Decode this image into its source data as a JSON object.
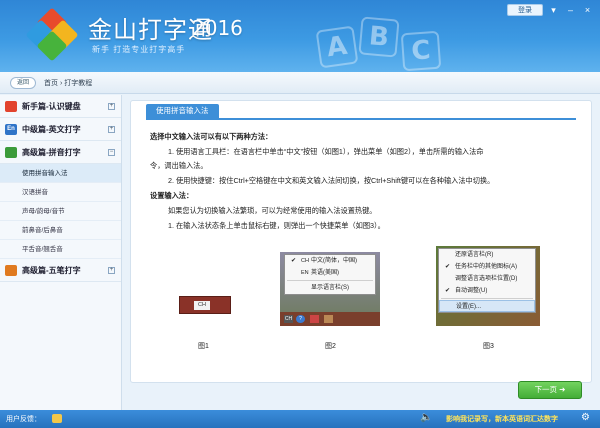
{
  "header": {
    "title": "金山打字通",
    "year": "2016",
    "subtitle": "新手 打造专业打字高手",
    "abc_letters": [
      "A",
      "B",
      "C"
    ],
    "login": "登录",
    "window_buttons": [
      "▾",
      "–",
      "×"
    ]
  },
  "nav": {
    "back": "返回",
    "breadcrumb": "首页 › 打字教程"
  },
  "sidebar": {
    "sections": [
      {
        "badge": "",
        "badge_color": "#e2432d",
        "label": "新手篇-认识键盘",
        "toggle": "+"
      },
      {
        "badge": "En",
        "badge_color": "#2f74c8",
        "label": "中级篇-英文打字",
        "toggle": "+"
      },
      {
        "badge": "",
        "badge_color": "#3b9b3a",
        "label": "高级篇-拼音打字",
        "toggle": "−"
      },
      {
        "badge": "",
        "badge_color": "#e07a1f",
        "label": "高级篇-五笔打字",
        "toggle": "+"
      }
    ],
    "subitems": [
      "使用拼音输入法",
      "汉语拼音",
      "声母/韵母/音节",
      "前鼻音/后鼻音",
      "平舌音/翘舌音"
    ]
  },
  "content": {
    "tab": "使用拼音输入法",
    "lines": [
      "选择中文输入法可以有以下两种方法：",
      "1. 使用语言工具栏：在语言栏中单击“中文”按钮（如图1），弹出菜单（如图2），单击所需的输入法命",
      "令，调出输入法。",
      "2. 使用快捷键：按住Ctrl+空格键在中文和英文输入法间切换，按Ctrl+Shift键可以在各种输入法中切换。",
      "设置输入法：",
      "如果您认为切换输入法繁琐，可以为经常使用的输入法设置热键。",
      "1. 在输入法状态条上单击鼠标右键，则弹出一个快捷菜单（如图3）。"
    ]
  },
  "figures": {
    "fig1": {
      "label": "CH",
      "caption": "图1"
    },
    "fig2": {
      "caption": "图2",
      "items": [
        {
          "check": "✔",
          "tag": "CH",
          "text": "中文(简体，中国)"
        },
        {
          "check": "",
          "tag": "EN",
          "text": "英语(美国)"
        },
        {
          "check": "",
          "tag": "",
          "text": "显示语言栏(S)"
        }
      ],
      "tray": [
        "CH",
        "?",
        "",
        ""
      ]
    },
    "fig3": {
      "caption": "图3",
      "items": [
        {
          "check": "",
          "text": "还原语言栏(R)"
        },
        {
          "check": "✔",
          "text": "任务栏中的其他图标(A)"
        },
        {
          "check": "",
          "text": "调整语言选项栏位置(D)"
        },
        {
          "check": "✔",
          "text": "自动调整(U)"
        },
        {
          "check": "",
          "text": "设置(E)..."
        }
      ]
    }
  },
  "next_button": "下一页  ➜",
  "status": {
    "feedback": "用户反馈：",
    "speaker_icon": "🔈",
    "promo": "影响我记录写，新本英语词汇达数字",
    "gear_icon": "⚙"
  }
}
